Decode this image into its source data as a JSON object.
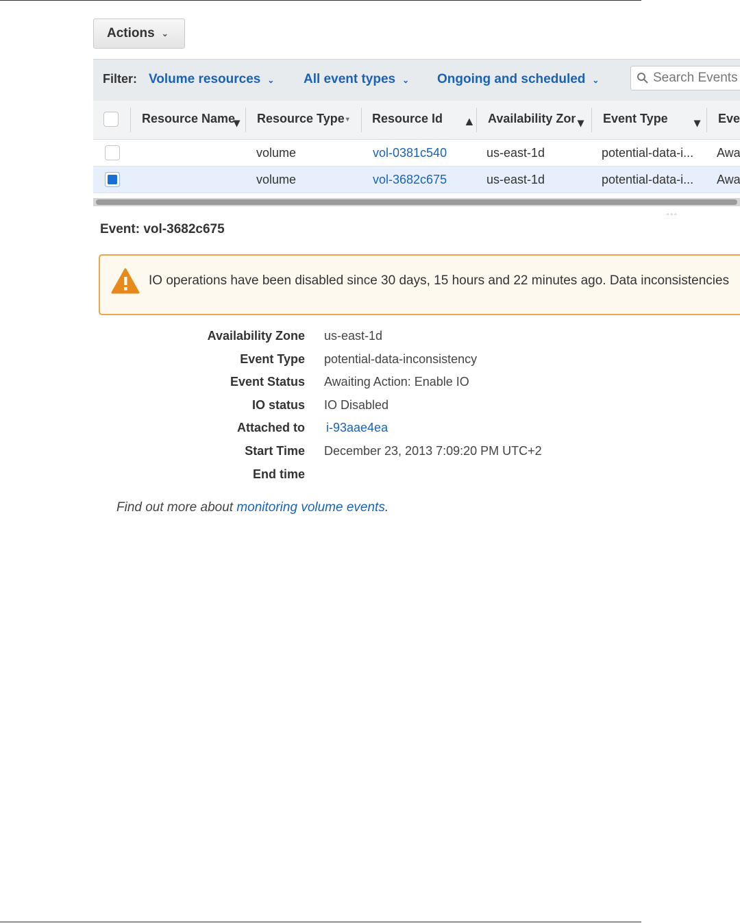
{
  "toolbar": {
    "actions_label": "Actions"
  },
  "filter": {
    "label": "Filter:",
    "resources": "Volume resources",
    "event_types": "All event types",
    "timing": "Ongoing and scheduled",
    "search_placeholder": "Search Events"
  },
  "table": {
    "columns": [
      "Resource Name",
      "Resource Type",
      "Resource Id",
      "Availability Zone",
      "Event Type",
      "Event Status"
    ],
    "rows": [
      {
        "selected": false,
        "resource_name": "",
        "resource_type": "volume",
        "resource_id": "vol-0381c540",
        "availability_zone": "us-east-1d",
        "event_type": "potential-data-i...",
        "event_status": "Awaiting Action: Enable IO"
      },
      {
        "selected": true,
        "resource_name": "",
        "resource_type": "volume",
        "resource_id": "vol-3682c675",
        "availability_zone": "us-east-1d",
        "event_type": "potential-data-i...",
        "event_status": "Awaiting Action: Enable IO"
      }
    ]
  },
  "detail": {
    "title": "Event: vol-3682c675",
    "alert_message": "IO operations have been disabled since 30 days, 15 hours and 22 minutes ago. Data inconsistencies",
    "fields": [
      {
        "label": "Availability Zone",
        "value": "us-east-1d"
      },
      {
        "label": "Event Type",
        "value": "potential-data-inconsistency"
      },
      {
        "label": "Event Status",
        "value": "Awaiting Action: Enable IO"
      },
      {
        "label": "IO status",
        "value": "IO Disabled"
      },
      {
        "label": "Attached to",
        "value": "i-93aae4ea"
      },
      {
        "label": "Start Time",
        "value": "December 23, 2013 7:09:20 PM UTC+2"
      },
      {
        "label": "End time",
        "value": ""
      }
    ],
    "footer_prefix": "Find out more about",
    "footer_link": "monitoring volume events",
    "footer_suffix": "."
  },
  "colors": {
    "link": "#1a62b7",
    "alert_border": "#f0a54a",
    "warning_icon": "#e8891c",
    "selected_row": "#e6effb"
  }
}
